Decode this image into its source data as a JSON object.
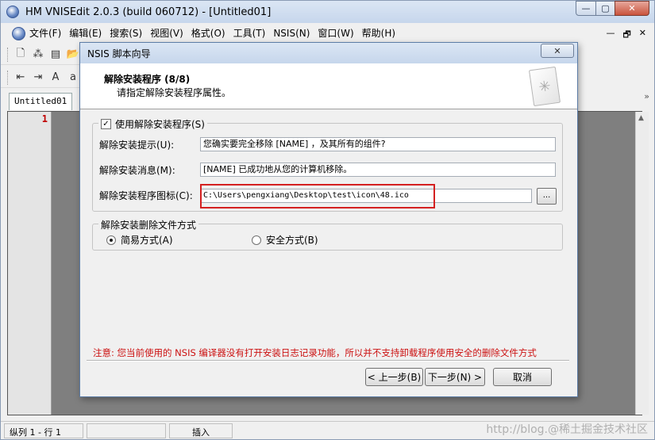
{
  "window": {
    "title": "HM VNISEdit 2.0.3 (build 060712) - [Untitled01]",
    "min_glyph": "—",
    "max_glyph": "▢",
    "close_glyph": "✕"
  },
  "menu": {
    "items": [
      "文件(F)",
      "编辑(E)",
      "搜索(S)",
      "视图(V)",
      "格式(O)",
      "工具(T)",
      "NSIS(N)",
      "窗口(W)",
      "帮助(H)"
    ],
    "right_controls": [
      "—",
      "🗗",
      "✕"
    ]
  },
  "toolbar": {
    "row1": [
      "🗋",
      "⁂",
      "▤",
      "📂"
    ],
    "row2": [
      "⇤",
      "⇥",
      "A",
      "a"
    ]
  },
  "tabs": {
    "doc": "Untitled01",
    "overflow": "»"
  },
  "editor": {
    "line_number": "1"
  },
  "status": {
    "position": "纵列 1 - 行 1",
    "mode": "插入",
    "watermark": "http://blog.@稀土掘金技术社区"
  },
  "dialog": {
    "title": "NSIS 脚本向导",
    "close_glyph": "✕",
    "header": {
      "title": "解除安装程序 (8/8)",
      "subtitle": "请指定解除安装程序属性。",
      "icon": "✳"
    },
    "uninstaller_group": {
      "checkbox_label": "使用解除安装程序(S)",
      "checked": true,
      "check_glyph": "✓",
      "prompt_label": "解除安装提示(U):",
      "prompt_value": "您确实要完全移除 [NAME] ，及其所有的组件?",
      "message_label": "解除安装消息(M):",
      "message_value": "[NAME] 已成功地从您的计算机移除。",
      "icon_label": "解除安装程序图标(C):",
      "icon_value": "C:\\Users\\pengxiang\\Desktop\\test\\icon\\48.ico",
      "browse_label": "..."
    },
    "delete_group": {
      "legend": "解除安装删除文件方式",
      "option_simple": "简易方式(A)",
      "option_safe": "安全方式(B)",
      "selected": "simple"
    },
    "note": "注意: 您当前使用的 NSIS 编译器没有打开安装日志记录功能，所以并不支持卸载程序使用安全的删除文件方式",
    "buttons": {
      "back": "< 上一步(B)",
      "next": "下一步(N) >",
      "cancel": "取消"
    }
  }
}
